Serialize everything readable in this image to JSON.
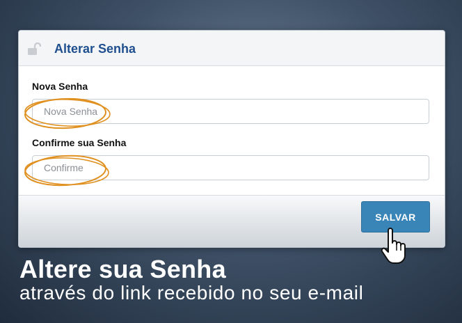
{
  "panel": {
    "title": "Alterar Senha",
    "icon": "unlock-icon"
  },
  "form": {
    "new_password": {
      "label": "Nova Senha",
      "placeholder": "Nova Senha"
    },
    "confirm_password": {
      "label": "Confirme sua Senha",
      "placeholder": "Confirme"
    },
    "save_label": "SALVAR"
  },
  "caption": {
    "headline": "Altere sua Senha",
    "subline": "através do link recebido no seu e-mail"
  },
  "colors": {
    "accent_title": "#1f4f8f",
    "button": "#3a85b8",
    "highlight": "#e0901f"
  },
  "cursor_icon": "hand-pointer-icon"
}
